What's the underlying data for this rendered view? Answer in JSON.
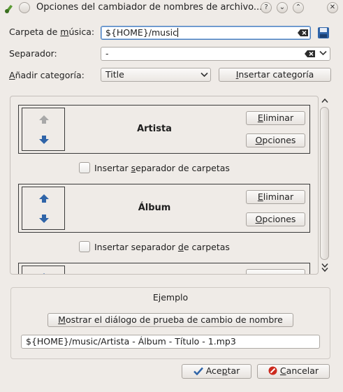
{
  "window": {
    "title": "Opciones del cambiador de nombres de archivo...",
    "buttons": {
      "help": "?",
      "minimize": "⌄",
      "maximize": "⌃",
      "close": "✕"
    }
  },
  "form": {
    "music_folder": {
      "label_pre": "Carpeta de ",
      "label_mn": "m",
      "label_post": "úsica:",
      "value": "${HOME}/music"
    },
    "separator": {
      "label": "Separador:",
      "value": "-"
    },
    "add_category": {
      "label_pre": "",
      "label_mn": "A",
      "label_post": "ñadir categoría:",
      "selected": "Title"
    },
    "insert_category_button": {
      "pre": "",
      "mn": "I",
      "post": "nsertar categoría"
    }
  },
  "categories": [
    {
      "name": "Artista"
    },
    {
      "name": "Álbum"
    }
  ],
  "category_buttons": {
    "delete": {
      "mn": "E",
      "post": "liminar"
    },
    "options": {
      "mn": "O",
      "post": "pciones"
    }
  },
  "folder_separator": {
    "pre": "Insertar ",
    "mn": "s",
    "post": "eparador de carpetas"
  },
  "folder_separator_2": {
    "pre": "Insertar separador ",
    "mn": "d",
    "post": "e carpetas"
  },
  "example": {
    "title": "Ejemplo",
    "preview_button": {
      "pre": "",
      "mn": "M",
      "post": "ostrar el diálogo de prueba de cambio de nombre"
    },
    "result": "${HOME}/music/Artista - Álbum - Título - 1.mp3"
  },
  "footer": {
    "accept": {
      "pre": "Ace",
      "mn": "p",
      "post": "tar"
    },
    "cancel": {
      "pre": "",
      "mn": "C",
      "post": "ancelar"
    }
  },
  "colors": {
    "arrow_blue": "#2f64a8",
    "arrow_gray": "#a8a8a8",
    "cancel_red": "#cc2a1e",
    "accent": "#4a7ebd"
  }
}
